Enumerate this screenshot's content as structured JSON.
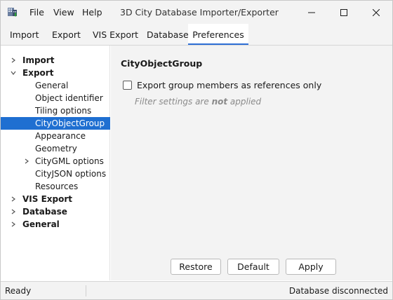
{
  "window": {
    "title": "3D City Database Importer/Exporter",
    "icon": "city-database-app-icon"
  },
  "menu": {
    "file": "File",
    "view": "View",
    "help": "Help"
  },
  "tabs": [
    {
      "label": "Import",
      "active": false
    },
    {
      "label": "Export",
      "active": false
    },
    {
      "label": "VIS Export",
      "active": false
    },
    {
      "label": "Database",
      "active": false
    },
    {
      "label": "Preferences",
      "active": true
    }
  ],
  "tree": {
    "items": [
      {
        "label": "Import",
        "level": 0,
        "expanded": false,
        "bold": true,
        "expandable": true
      },
      {
        "label": "Export",
        "level": 0,
        "expanded": true,
        "bold": true,
        "expandable": true
      },
      {
        "label": "General",
        "level": 1,
        "expandable": false
      },
      {
        "label": "Object identifier",
        "level": 1,
        "expandable": false
      },
      {
        "label": "Tiling options",
        "level": 1,
        "expandable": false
      },
      {
        "label": "CityObjectGroup",
        "level": 1,
        "expandable": false,
        "selected": true
      },
      {
        "label": "Appearance",
        "level": 1,
        "expandable": false
      },
      {
        "label": "Geometry",
        "level": 1,
        "expandable": false
      },
      {
        "label": "CityGML options",
        "level": 1,
        "expandable": true,
        "expanded": false
      },
      {
        "label": "CityJSON options",
        "level": 1,
        "expandable": false
      },
      {
        "label": "Resources",
        "level": 1,
        "expandable": false
      },
      {
        "label": "VIS Export",
        "level": 0,
        "expanded": false,
        "bold": true,
        "expandable": true
      },
      {
        "label": "Database",
        "level": 0,
        "expanded": false,
        "bold": true,
        "expandable": true
      },
      {
        "label": "General",
        "level": 0,
        "expanded": false,
        "bold": true,
        "expandable": true
      }
    ]
  },
  "panel": {
    "title": "CityObjectGroup",
    "checkbox_label": "Export group members as references only",
    "checkbox_checked": false,
    "hint_prefix": "Filter settings are ",
    "hint_emphasis": "not",
    "hint_suffix": " applied"
  },
  "buttons": {
    "restore": "Restore",
    "default": "Default",
    "apply": "Apply"
  },
  "status": {
    "left": "Ready",
    "right": "Database disconnected"
  },
  "colors": {
    "accent": "#1f6fd1",
    "tab_indicator": "#2e6fd6",
    "chrome_bg": "#f3f3f3"
  }
}
